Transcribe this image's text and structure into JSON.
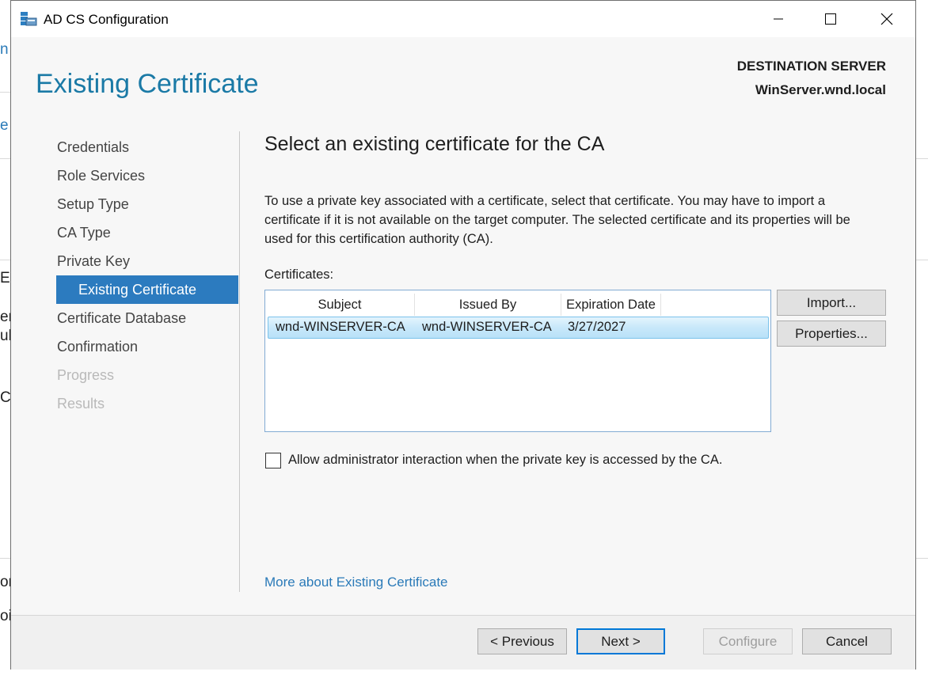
{
  "background_fragments": [
    "n",
    "e",
    "E",
    "er",
    "ub",
    "C",
    "or",
    "oi"
  ],
  "window": {
    "title": "AD CS Configuration",
    "icon": "server-manager-icon",
    "controls": [
      "minimize-icon",
      "maximize-icon",
      "close-icon"
    ]
  },
  "header": {
    "page_title": "Existing Certificate",
    "destination_label": "DESTINATION SERVER",
    "destination_value": "WinServer.wnd.local"
  },
  "nav": {
    "items": [
      {
        "label": "Credentials",
        "state": "normal"
      },
      {
        "label": "Role Services",
        "state": "normal"
      },
      {
        "label": "Setup Type",
        "state": "normal"
      },
      {
        "label": "CA Type",
        "state": "normal"
      },
      {
        "label": "Private Key",
        "state": "normal"
      },
      {
        "label": "Existing Certificate",
        "state": "selected"
      },
      {
        "label": "Certificate Database",
        "state": "normal"
      },
      {
        "label": "Confirmation",
        "state": "normal"
      },
      {
        "label": "Progress",
        "state": "disabled"
      },
      {
        "label": "Results",
        "state": "disabled"
      }
    ]
  },
  "main": {
    "section_title": "Select an existing certificate for the CA",
    "description": "To use a private key associated with a certificate, select that certificate. You may have to import a certificate if it is not available on the target computer. The selected certificate and its properties will be used for this certification authority (CA).",
    "certificates_label": "Certificates:",
    "columns": [
      "Subject",
      "Issued By",
      "Expiration Date"
    ],
    "rows": [
      {
        "subject": "wnd-WINSERVER-CA",
        "issued_by": "wnd-WINSERVER-CA",
        "expiration": "3/27/2027",
        "selected": true
      }
    ],
    "import_button": "Import...",
    "properties_button": "Properties...",
    "checkbox_label": "Allow administrator interaction when the private key is accessed by the CA.",
    "checkbox_checked": false,
    "more_link": "More about Existing Certificate"
  },
  "footer": {
    "previous": "< Previous",
    "next": "Next >",
    "configure": "Configure",
    "cancel": "Cancel"
  },
  "colors": {
    "title_blue": "#1b7aa6",
    "nav_selected": "#2c7bbf",
    "link": "#2a7ab8",
    "selection_border": "#7bc2ea"
  }
}
